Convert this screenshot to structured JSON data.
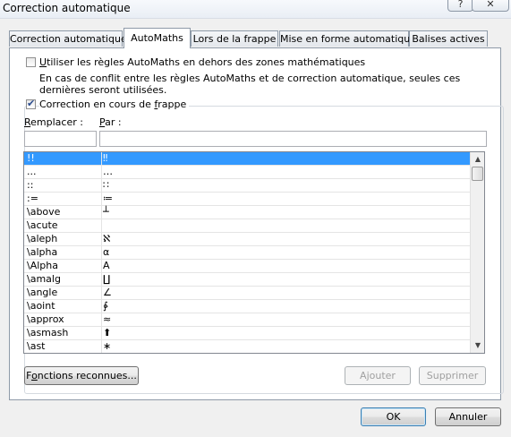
{
  "window": {
    "title": "Correction automatique",
    "help_icon": "?",
    "close_icon": "✕"
  },
  "tabs": [
    {
      "label": "Correction automatique",
      "active": false
    },
    {
      "label": "AutoMaths",
      "active": true
    },
    {
      "label": "Lors de la frappe",
      "active": false
    },
    {
      "label": "Mise en forme automatique",
      "active": false
    },
    {
      "label": "Balises actives",
      "active": false
    }
  ],
  "options": {
    "use_outside": {
      "label_u": "U",
      "label_rest": "tiliser les règles AutoMaths en dehors des zones mathématiques",
      "checked": false
    },
    "conflict_note": "En cas de conflit entre les règles AutoMaths et de correction automatique, seules ces dernières seront utilisées.",
    "replace_typing": {
      "label_before": "Correction en cours de ",
      "label_u": "f",
      "label_after": "rappe",
      "checked": true
    }
  },
  "fields": {
    "replace_label_u": "R",
    "replace_label_rest": "emplacer :",
    "replace_value": "",
    "with_label_u": "P",
    "with_label_rest": "ar :",
    "with_value": ""
  },
  "list": {
    "rows": [
      {
        "key": "!!",
        "value": "‼"
      },
      {
        "key": "...",
        "value": "…"
      },
      {
        "key": "::",
        "value": "∷"
      },
      {
        "key": ":=",
        "value": "≔"
      },
      {
        "key": "\\above",
        "value": "┴"
      },
      {
        "key": "\\acute",
        "value": ""
      },
      {
        "key": "\\aleph",
        "value": "ℵ"
      },
      {
        "key": "\\alpha",
        "value": "α"
      },
      {
        "key": "\\Alpha",
        "value": "Α"
      },
      {
        "key": "\\amalg",
        "value": "∐"
      },
      {
        "key": "\\angle",
        "value": "∠"
      },
      {
        "key": "\\aoint",
        "value": "∳"
      },
      {
        "key": "\\approx",
        "value": "≈"
      },
      {
        "key": "\\asmash",
        "value": "⬆"
      },
      {
        "key": "\\ast",
        "value": "∗"
      }
    ],
    "selected_index": 0,
    "scroll_up_icon": "▲",
    "scroll_down_icon": "▼"
  },
  "buttons": {
    "functions_u": "o",
    "functions_before": "F",
    "functions_after": "nctions reconnues...",
    "add": "Ajouter",
    "delete": "Supprimer",
    "ok": "OK",
    "cancel": "Annuler"
  }
}
